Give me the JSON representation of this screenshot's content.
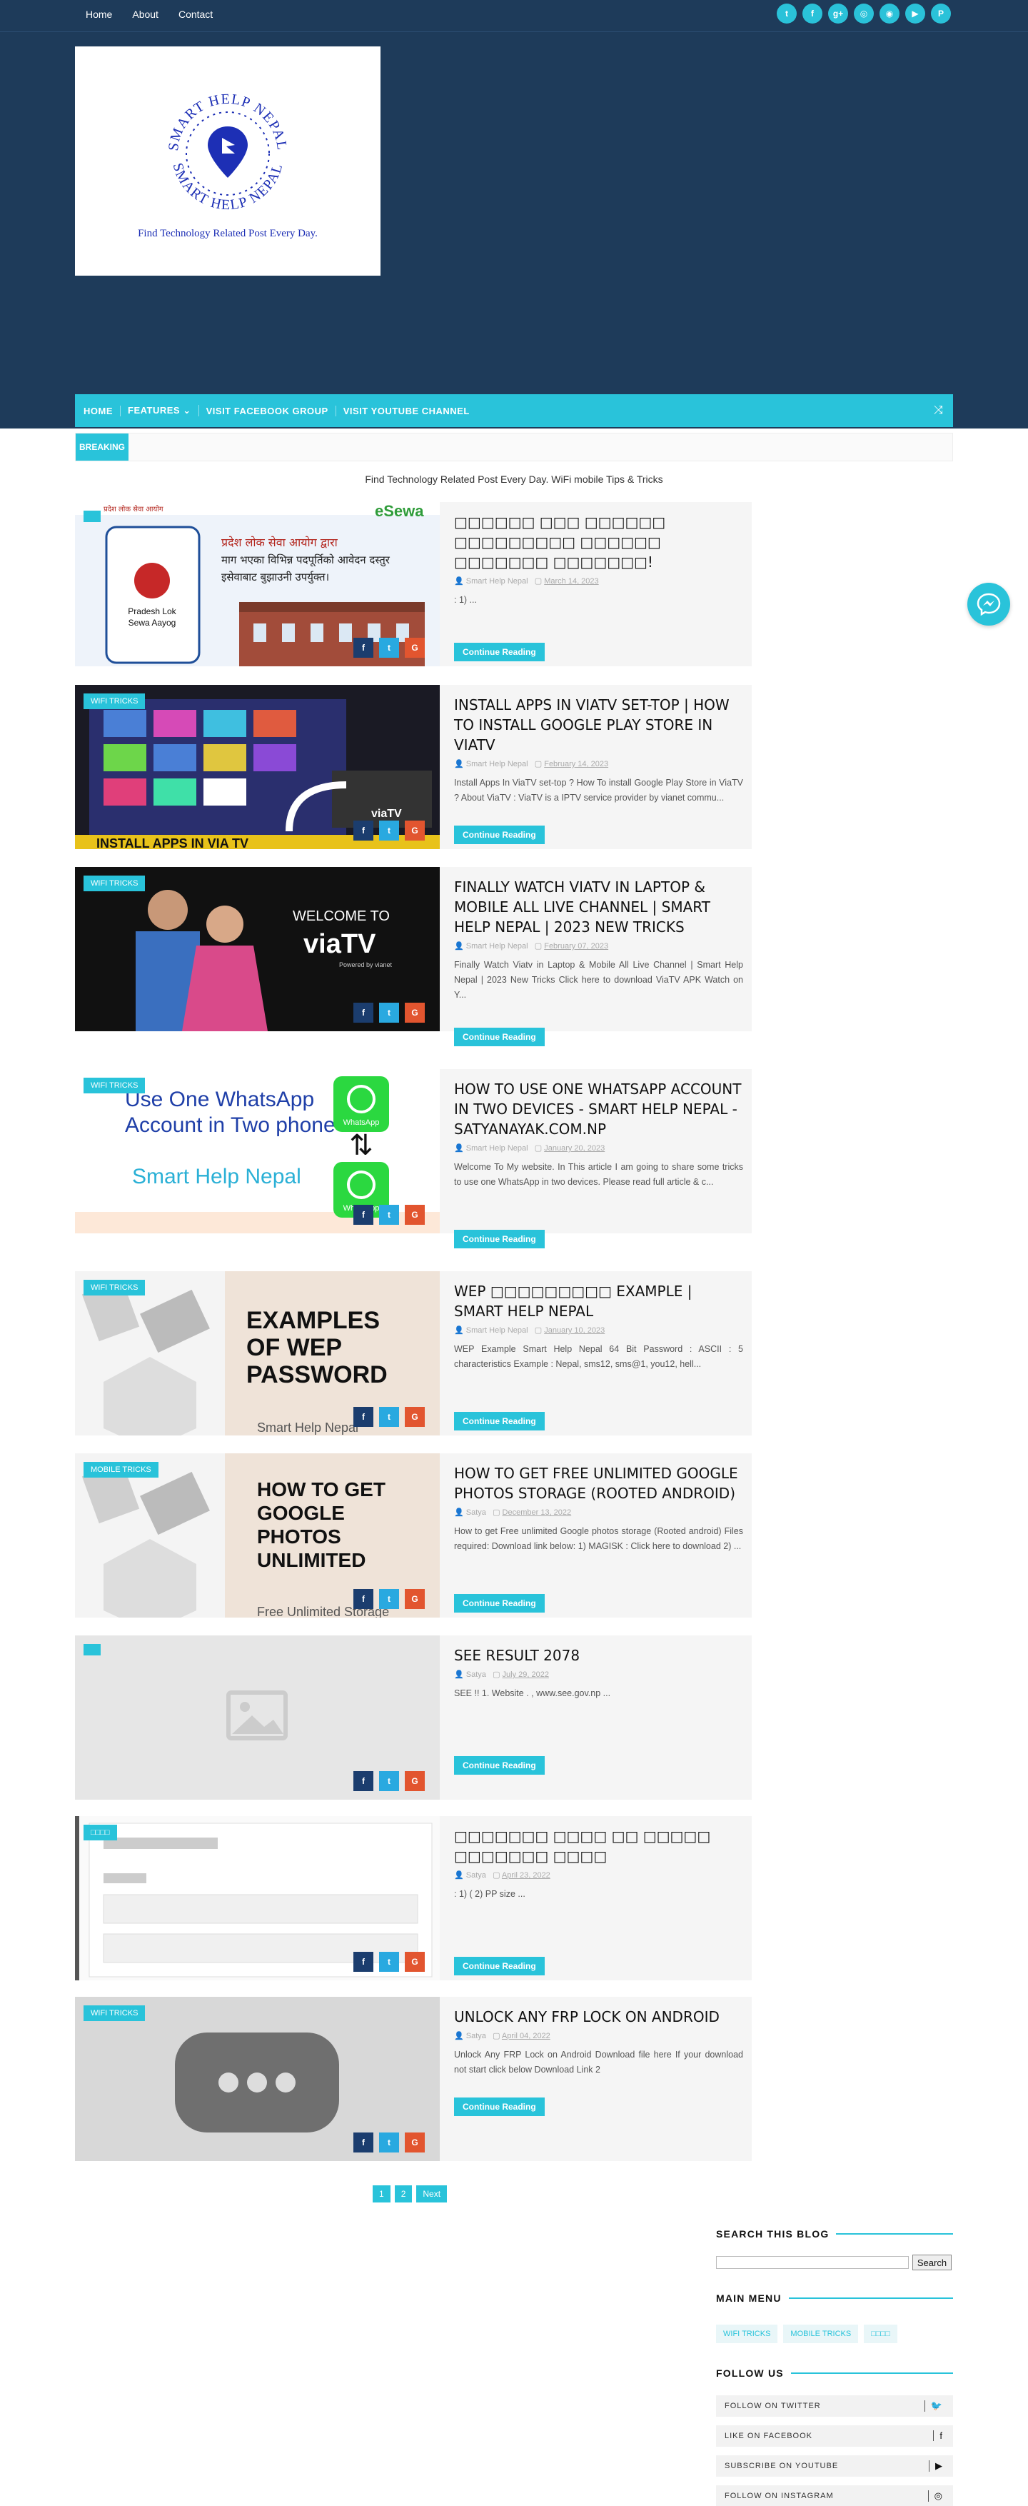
{
  "topnav": {
    "links": [
      "Home",
      "About",
      "Contact"
    ]
  },
  "social_icons": [
    {
      "name": "twitter-icon",
      "glyph": "t"
    },
    {
      "name": "facebook-icon",
      "glyph": "f"
    },
    {
      "name": "google-plus-icon",
      "glyph": "g+"
    },
    {
      "name": "instagram-icon",
      "glyph": "◎"
    },
    {
      "name": "rss-icon",
      "glyph": "◉"
    },
    {
      "name": "youtube-icon",
      "glyph": "▶"
    },
    {
      "name": "pinterest-icon",
      "glyph": "P"
    }
  ],
  "logo": {
    "ring_top": "SMART HELP NEPAL",
    "ring_bottom": "SMART HELP NEPAL",
    "tagline": "Find Technology Related Post Every Day."
  },
  "mainnav": {
    "items": [
      "HOME",
      "FEATURES ⌄",
      "VISIT FACEBOOK GROUP",
      "VISIT YOUTUBE CHANNEL"
    ]
  },
  "breaking": {
    "label": "BREAKING"
  },
  "tagline": "Find Technology Related Post Every Day. WiFi mobile Tips & Tricks",
  "posts": [
    {
      "label": "",
      "title": "□□□□□□ □□□ □□□□□□ □□□□□□□□□ □□□□□□ □□□□□□□ □□□□□□□!",
      "author": "Smart Help Nepal",
      "date": "March 14, 2023",
      "snippet": ": 1) ..."
    },
    {
      "label": "WIFI TRICKS",
      "title": "Install Apps In ViaTV set-top | How To Install Google Play Store in ViaTV",
      "author": "Smart Help Nepal",
      "date": "February 14, 2023",
      "snippet": "Install Apps In ViaTV set-top ? How To install Google Play Store in ViaTV ? About ViaTV : ViaTV is a IPTV service provider by vianet commu..."
    },
    {
      "label": "WIFI TRICKS",
      "title": "Finally Watch ViaTv in Laptop & Mobile All Live Channel | Smart Help Nepal | 2023 New Tricks",
      "author": "Smart Help Nepal",
      "date": "February 07, 2023",
      "snippet": "Finally Watch Viatv in Laptop & Mobile All Live Channel | Smart Help Nepal | 2023 New Tricks Click here to download ViaTV APK Watch on Y..."
    },
    {
      "label": "WIFI TRICKS",
      "title": "How to use one WhatsApp account in two devices - Smart Help Nepal - satyanayak.com.np",
      "author": "Smart Help Nepal",
      "date": "January 20, 2023",
      "snippet": "Welcome To My website. In This article I am going to share some tricks to use one WhatsApp in two devices. Please read full article & c..."
    },
    {
      "label": "WIFI TRICKS",
      "title": "WEP □□□□□□□□□ Example | Smart Help Nepal",
      "author": "Smart Help Nepal",
      "date": "January 10, 2023",
      "snippet": "WEP Example Smart Help Nepal 64 Bit Password : ASCII : 5 characteristics Example : Nepal, sms12, sms@1, you12, hell..."
    },
    {
      "label": "MOBILE TRICKS",
      "title": "How to get free unlimited google photos storage (rooted android)",
      "author": "Satya",
      "date": "December 13, 2022",
      "snippet": "How to get Free unlimited Google photos storage (Rooted android) Files required: Download link below: 1) MAGISK : Click here to download 2) ..."
    },
    {
      "label": "",
      "title": "SEE Result 2078",
      "author": "Satya",
      "date": "July 29, 2022",
      "snippet": "SEE !! 1. Website . , www.see.gov.np ..."
    },
    {
      "label": "□□□□",
      "title": "□□□□□□□ □□□□ □□ □□□□□ □□□□□□□ □□□□",
      "author": "Satya",
      "date": "April 23, 2022",
      "snippet": ": 1) ( 2) PP size ..."
    },
    {
      "label": "WIFI TRICKS",
      "title": "Unlock Any FRP Lock on Android",
      "author": "Satya",
      "date": "April 04, 2022",
      "snippet": "Unlock Any FRP Lock on Android Download file here If your download not start click below Download Link 2"
    }
  ],
  "thumbs": {
    "p1": {
      "brand": "eSewa",
      "sign_top": "प्रदेश लोक सेवा आयोग",
      "line1": "प्रदेश लोक सेवा आयोग द्वारा",
      "line2": "माग भएका विभिन्न पदपूर्तिको आवेदन दस्तुर",
      "line3": "इसेवाबाट बुझाउनी उपर्युक्त।",
      "phone_label1": "Pradesh Lok",
      "phone_label2": "Sewa Aayog"
    },
    "p2": {
      "tv_brand": "viaTV",
      "banner": "INSTALL APPS IN VIA TV"
    },
    "p3": {
      "welcome": "WELCOME TO",
      "brand": "viaTV",
      "powered": "Powered by vianet"
    },
    "p4": {
      "line1": "Use One WhatsApp",
      "line2": "Account in Two phone",
      "sub": "Smart Help Nepal",
      "app": "WhatsApp"
    },
    "p5": {
      "text": "EXAMPLES OF WEP PASSWORD",
      "sub": "Smart Help Nepal"
    },
    "p6": {
      "text": "HOW TO GET GOOGLE PHOTOS UNLIMITED",
      "sub": "Free Unlimited Storage"
    }
  },
  "read_more": "Continue Reading",
  "pager": [
    "1",
    "2",
    "Next"
  ],
  "sidebar": {
    "search_title": "SEARCH THIS BLOG",
    "search_button": "Search",
    "menu_title": "MAIN MENU",
    "menu_tags": [
      "WIFI TRICKS",
      "MOBILE TRICKS",
      "□□□□"
    ],
    "follow_title": "FOLLOW US",
    "follow": [
      {
        "text": "FOLLOW ON TWITTER",
        "icon": "twitter-icon",
        "glyph": "🐦"
      },
      {
        "text": "LIKE ON FACEBOOK",
        "icon": "facebook-icon",
        "glyph": "f"
      },
      {
        "text": "SUBSCRIBE ON YOUTUBE",
        "icon": "youtube-icon",
        "glyph": "▶"
      },
      {
        "text": "FOLLOW ON INSTAGRAM",
        "icon": "instagram-icon",
        "glyph": "◎"
      }
    ]
  }
}
